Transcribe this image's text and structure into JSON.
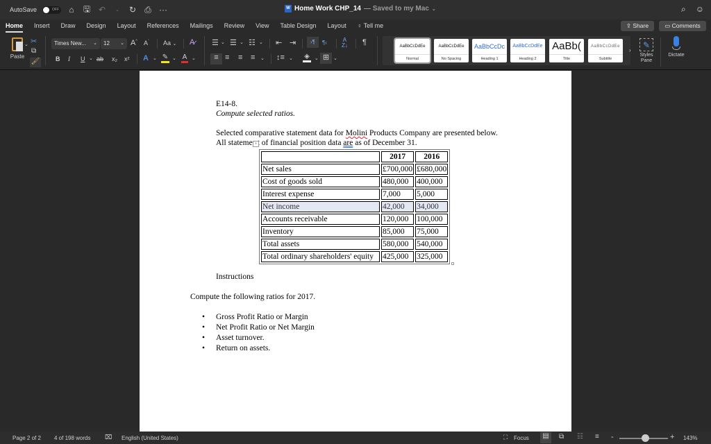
{
  "titlebar": {
    "autosave_label": "AutoSave",
    "autosave_state": "OFF",
    "icons": [
      "home-icon",
      "save-icon",
      "undo-icon",
      "redo-icon",
      "print-icon",
      "more-icon"
    ],
    "more": "···",
    "doc_name": "Home Work CHP_14",
    "saved_status": "— Saved to my Mac",
    "right_icons": [
      "search-icon",
      "feedback-smiley-icon"
    ]
  },
  "tabs": [
    "Home",
    "Insert",
    "Draw",
    "Design",
    "Layout",
    "References",
    "Mailings",
    "Review",
    "View",
    "Table Design",
    "Layout"
  ],
  "tell_me": "Tell me",
  "share_label": "Share",
  "comments_label": "Comments",
  "ribbon": {
    "paste_label": "Paste",
    "font_name": "Times New...",
    "font_size": "12",
    "case_label": "Aa",
    "bold": "B",
    "italic": "I",
    "underline": "U",
    "strike": "ab",
    "subscript": "x₂",
    "superscript": "x²",
    "styles": [
      {
        "sample": "AaBbCcDdEe",
        "name": "Normal",
        "selected": true
      },
      {
        "sample": "AaBbCcDdEe",
        "name": "No Spacing"
      },
      {
        "sample": "AaBbCcDc",
        "name": "Heading 1"
      },
      {
        "sample": "AaBbCcDdEe",
        "name": "Heading 2"
      },
      {
        "sample": "AaBb(",
        "name": "Title"
      },
      {
        "sample": "AaBbCcDdEe",
        "name": "Subtitle"
      }
    ],
    "styles_pane_label": "Styles Pane",
    "dictate_label": "Dictate",
    "accent_colors": {
      "highlight": "#f5e51b",
      "font_color": "#e0302a",
      "heading_blue": "#2f6bd0"
    }
  },
  "document": {
    "exercise_id": "E14-8.",
    "subtitle": "Compute selected ratios.",
    "intro_line1_a": "Selected comparative statement data for ",
    "intro_company": "Molini",
    "intro_line1_b": " Products Company are presented below.",
    "intro_line2_a": "All stateme",
    "intro_line2_b": "t of financial position data ",
    "intro_are": "are",
    "intro_line2_c": " as of December 31.",
    "table": {
      "headers": [
        "",
        "2017",
        "2016"
      ],
      "rows": [
        [
          "Net sales",
          "£700,000",
          "£680,000"
        ],
        [
          "Cost of goods sold",
          "480,000",
          "400,000"
        ],
        [
          "Interest expense",
          "7,000",
          "5,000"
        ],
        [
          "Net income",
          "42,000",
          "34,000"
        ],
        [
          "Accounts receivable",
          "120,000",
          "100,000"
        ],
        [
          "Inventory",
          "85,000",
          "75,000"
        ],
        [
          "Total assets",
          "580,000",
          "540,000"
        ],
        [
          "Total ordinary shareholders' equity",
          "425,000",
          "325,000"
        ]
      ],
      "highlighted_row": 3
    },
    "instructions_heading": "Instructions",
    "instructions_text": "Compute the following ratios for 2017.",
    "bullets": [
      "Gross Profit Ratio or Margin",
      "Net Profit Ratio or Net Margin",
      "Asset turnover.",
      "Return on assets."
    ]
  },
  "statusbar": {
    "page": "Page 2 of 2",
    "words": "4 of 198 words",
    "language": "English (United States)",
    "focus": "Focus",
    "zoom_minus": "-",
    "zoom_plus": "+",
    "zoom_level": "143%"
  }
}
